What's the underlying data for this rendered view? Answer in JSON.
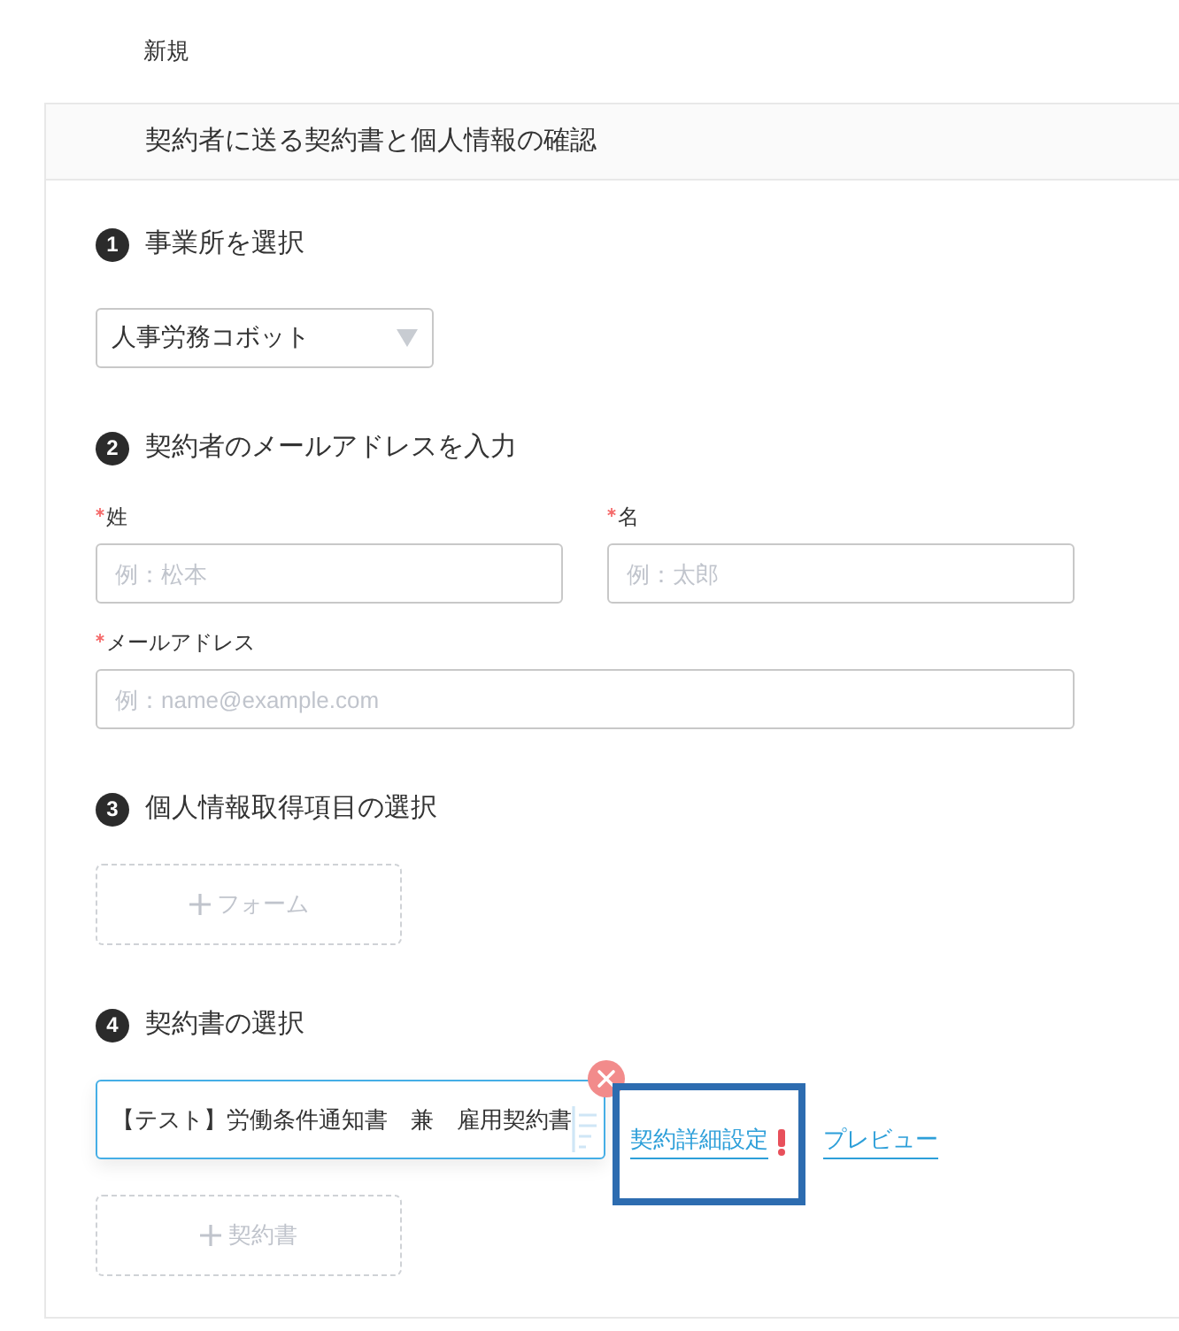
{
  "header": {
    "title": "新規"
  },
  "panel": {
    "title": "契約者に送る契約書と個人情報の確認",
    "steps": [
      {
        "number": "1",
        "title": "事業所を選択",
        "kind": "select",
        "select": {
          "value": "人事労務コボット"
        }
      },
      {
        "number": "2",
        "title": "契約者のメールアドレスを入力",
        "kind": "fields",
        "rows": [
          {
            "fields": [
              {
                "label": "姓",
                "required": true,
                "placeholder": "例：松本"
              },
              {
                "label": "名",
                "required": true,
                "placeholder": "例：太郎"
              }
            ]
          },
          {
            "fields": [
              {
                "label": "メールアドレス",
                "required": true,
                "placeholder": "例：name@example.com"
              }
            ]
          }
        ]
      },
      {
        "number": "3",
        "title": "個人情報取得項目の選択",
        "kind": "add",
        "add_button": {
          "label": "フォーム"
        }
      },
      {
        "number": "4",
        "title": "契約書の選択",
        "kind": "contracts",
        "contracts": [
          {
            "name": "【テスト】労働条件通知書　兼　雇用契約書",
            "links": [
              {
                "label": "契約詳細設定",
                "warning": true,
                "highlighted": true
              },
              {
                "label": "プレビュー",
                "warning": false,
                "highlighted": false
              }
            ]
          }
        ],
        "add_button": {
          "label": "契約書"
        }
      }
    ]
  }
}
